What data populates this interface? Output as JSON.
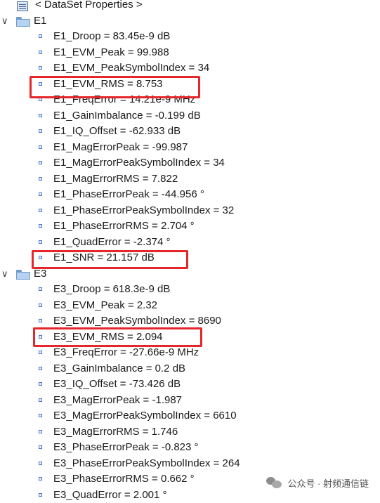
{
  "header": {
    "label": "< DataSet Properties >"
  },
  "groups": [
    {
      "name": "E1",
      "items": [
        "E1_Droop = 83.45e-9 dB",
        "E1_EVM_Peak = 99.988",
        "E1_EVM_PeakSymbolIndex = 34",
        "E1_EVM_RMS = 8.753",
        "E1_FreqError = 14.21e-9 MHz",
        "E1_GainImbalance = -0.199 dB",
        "E1_IQ_Offset = -62.933 dB",
        "E1_MagErrorPeak = -99.987",
        "E1_MagErrorPeakSymbolIndex = 34",
        "E1_MagErrorRMS = 7.822",
        "E1_PhaseErrorPeak = -44.956 °",
        "E1_PhaseErrorPeakSymbolIndex = 32",
        "E1_PhaseErrorRMS = 2.704 °",
        "E1_QuadError = -2.374 °",
        "E1_SNR = 21.157 dB"
      ]
    },
    {
      "name": "E3",
      "items": [
        "E3_Droop = 618.3e-9 dB",
        "E3_EVM_Peak = 2.32",
        "E3_EVM_PeakSymbolIndex = 8690",
        "E3_EVM_RMS = 2.094",
        "E3_FreqError = -27.66e-9 MHz",
        "E3_GainImbalance = 0.2 dB",
        "E3_IQ_Offset = -73.426 dB",
        "E3_MagErrorPeak = -1.987",
        "E3_MagErrorPeakSymbolIndex = 6610",
        "E3_MagErrorRMS = 1.746",
        "E3_PhaseErrorPeak = -0.823 °",
        "E3_PhaseErrorPeakSymbolIndex = 264",
        "E3_PhaseErrorRMS = 0.662 °",
        "E3_QuadError = 2.001 °"
      ]
    }
  ],
  "watermark": {
    "text": "公众号 · 射频通信链"
  },
  "colors": {
    "highlight_box": "#e5262b",
    "folder": "#b7d2ee"
  }
}
